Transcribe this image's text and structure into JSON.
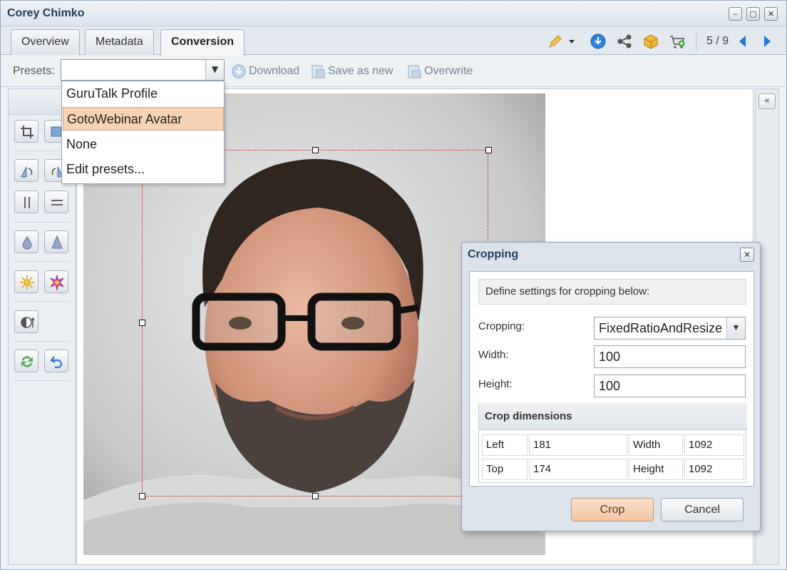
{
  "window": {
    "title": "Corey Chimko",
    "controls": {
      "minimize": "‒",
      "maximize": "▢",
      "close": "✕"
    }
  },
  "tabs": [
    {
      "label": "Overview",
      "active": false
    },
    {
      "label": "Metadata",
      "active": false
    },
    {
      "label": "Conversion",
      "active": true
    }
  ],
  "top_toolbar": {
    "icons": [
      "pencil-icon",
      "dropdown-caret-icon",
      "download-circle-icon",
      "share-icon",
      "package-icon",
      "cart-add-icon",
      "prev-arrow-icon",
      "next-arrow-icon"
    ],
    "pager": "5 / 9"
  },
  "presets": {
    "label": "Presets:",
    "value": "",
    "options": [
      "GuruTalk Profile",
      "GotoWebinar Avatar",
      "None",
      "Edit presets..."
    ],
    "highlighted": "GotoWebinar Avatar"
  },
  "actions": {
    "download": "Download",
    "save_as_new": "Save as new",
    "overwrite": "Overwrite"
  },
  "tools": [
    "crop-icon",
    "resize-icon",
    "rotate-left-icon",
    "rotate-right-icon",
    "flip-vertical-icon",
    "flip-horizontal-icon",
    "blur-icon",
    "sharpen-icon",
    "brightness-icon",
    "saturation-icon",
    "contrast-icon",
    "refresh-icon",
    "undo-icon"
  ],
  "cropping_dialog": {
    "title": "Cropping",
    "hint": "Define settings for cropping below:",
    "cropping_label": "Cropping:",
    "cropping_value": "FixedRatioAndResize",
    "width_label": "Width:",
    "width_value": "100",
    "height_label": "Height:",
    "height_value": "100",
    "dims_title": "Crop dimensions",
    "dims": {
      "left_label": "Left",
      "left": "181",
      "width_label": "Width",
      "width": "1092",
      "top_label": "Top",
      "top": "174",
      "height_label": "Height",
      "height": "1092"
    },
    "crop_button": "Crop",
    "cancel_button": "Cancel"
  },
  "colors": {
    "accent_title": "#1f3b5c",
    "selection": "#f7d3b3",
    "crop_border": "#c0231a",
    "icon_blue": "#1e7ad6"
  }
}
